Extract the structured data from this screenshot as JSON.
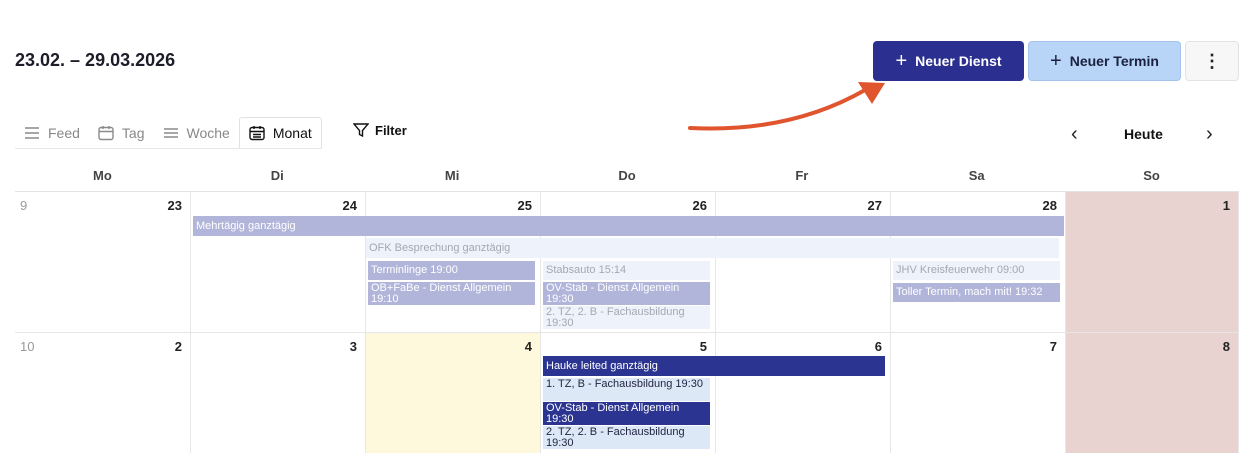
{
  "header": {
    "range": "23.02. – 29.03.2026",
    "new_duty_label": "Neuer Dienst",
    "new_appointment_label": "Neuer Termin",
    "more_label": "⋮"
  },
  "views": [
    {
      "label": "Feed",
      "icon": "list-icon"
    },
    {
      "label": "Tag",
      "icon": "calendar-icon"
    },
    {
      "label": "Woche",
      "icon": "menu-icon"
    },
    {
      "label": "Monat",
      "icon": "calendar-month-icon",
      "active": true
    }
  ],
  "filter_label": "Filter",
  "nav": {
    "prev": "‹",
    "today": "Heute",
    "next": "›"
  },
  "weekdays": [
    "Mo",
    "Di",
    "Mi",
    "Do",
    "Fr",
    "Sa",
    "So"
  ],
  "weeks": [
    {
      "week": "9",
      "days": [
        "23",
        "24",
        "25",
        "26",
        "27",
        "28",
        "1"
      ]
    },
    {
      "week": "10",
      "days": [
        "2",
        "3",
        "4",
        "5",
        "6",
        "7",
        "8"
      ]
    }
  ],
  "events": {
    "mehrtaegig": "Mehrtägig ganztägig",
    "ofk": "OFK Besprechung ganztägig",
    "terminlinge": "Terminlinge 19:00",
    "ob_fabe": "OB+FaBe - Dienst Allgemein 19:10",
    "stabsauto": "Stabsauto 15:14",
    "ov_stab_1": "OV-Stab - Dienst Allgemein 19:30",
    "tz2_1": "2. TZ, 2. B - Fachausbildung 19:30",
    "jhv": "JHV Kreisfeuerwehr 09:00",
    "toller": "Toller Termin, mach mit! 19:32",
    "hauke": "Hauke leited ganztägig",
    "tz1": "1. TZ, B - Fachausbildung 19:30",
    "ov_stab_2": "OV-Stab - Dienst Allgemein 19:30",
    "tz2_2": "2. TZ, 2. B - Fachausbildung 19:30"
  },
  "colors": {
    "primary": "#2b2f90",
    "secondary": "#b8d4f6",
    "sunday": "#e8d3d1",
    "today": "#fef9dc",
    "arrow": "#e0552e"
  }
}
